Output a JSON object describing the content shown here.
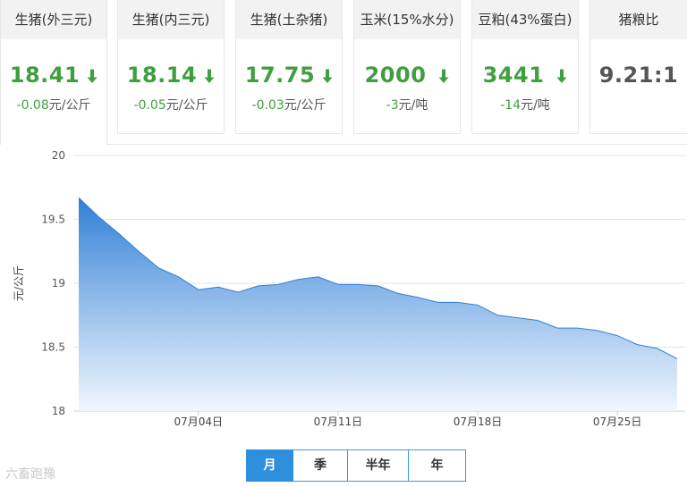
{
  "tabs": [
    {
      "label": "生猪(外三元)",
      "price": "18.41",
      "change": "-0.08",
      "unit": "元/公斤",
      "direction": "down"
    },
    {
      "label": "生猪(内三元)",
      "price": "18.14",
      "change": "-0.05",
      "unit": "元/公斤",
      "direction": "down"
    },
    {
      "label": "生猪(土杂猪)",
      "price": "17.75",
      "change": "-0.03",
      "unit": "元/公斤",
      "direction": "down"
    },
    {
      "label": "玉米(15%水分)",
      "price": "2000",
      "change": "-3",
      "unit": "元/吨",
      "direction": "down"
    },
    {
      "label": "豆粕(43%蛋白)",
      "price": "3441",
      "change": "-14",
      "unit": "元/吨",
      "direction": "down"
    },
    {
      "label": "猪粮比",
      "price": "9.21:1"
    }
  ],
  "colors": {
    "down": "#3f9f3f",
    "accent": "#2e90dc",
    "area_top": "#2f7fd6",
    "area_bottom": "#eef5fd"
  },
  "chart_data": {
    "type": "area",
    "ylabel": "元/公斤",
    "ylim": [
      18,
      20
    ],
    "yticks": [
      "20",
      "19.5",
      "19",
      "18.5",
      "18"
    ],
    "xticks": [
      "07月04日",
      "07月11日",
      "07月18日",
      "07月25日"
    ],
    "x": [
      "06月28日",
      "06月29日",
      "06月30日",
      "07月01日",
      "07月02日",
      "07月03日",
      "07月04日",
      "07月05日",
      "07月06日",
      "07月07日",
      "07月08日",
      "07月09日",
      "07月10日",
      "07月11日",
      "07月12日",
      "07月13日",
      "07月14日",
      "07月15日",
      "07月16日",
      "07月17日",
      "07月18日",
      "07月19日",
      "07月20日",
      "07月21日",
      "07月22日",
      "07月23日",
      "07月24日",
      "07月25日",
      "07月26日",
      "07月27日",
      "07月28日"
    ],
    "values": [
      19.67,
      19.52,
      19.39,
      19.25,
      19.12,
      19.05,
      18.95,
      18.97,
      18.93,
      18.98,
      18.99,
      19.03,
      19.05,
      18.99,
      18.99,
      18.98,
      18.92,
      18.89,
      18.85,
      18.85,
      18.83,
      18.75,
      18.73,
      18.71,
      18.65,
      18.65,
      18.63,
      18.59,
      18.52,
      18.49,
      18.41
    ],
    "grid": true
  },
  "range_buttons": [
    "月",
    "季",
    "半年",
    "年"
  ],
  "range_selected": "月",
  "watermark": "六畜跑豫"
}
